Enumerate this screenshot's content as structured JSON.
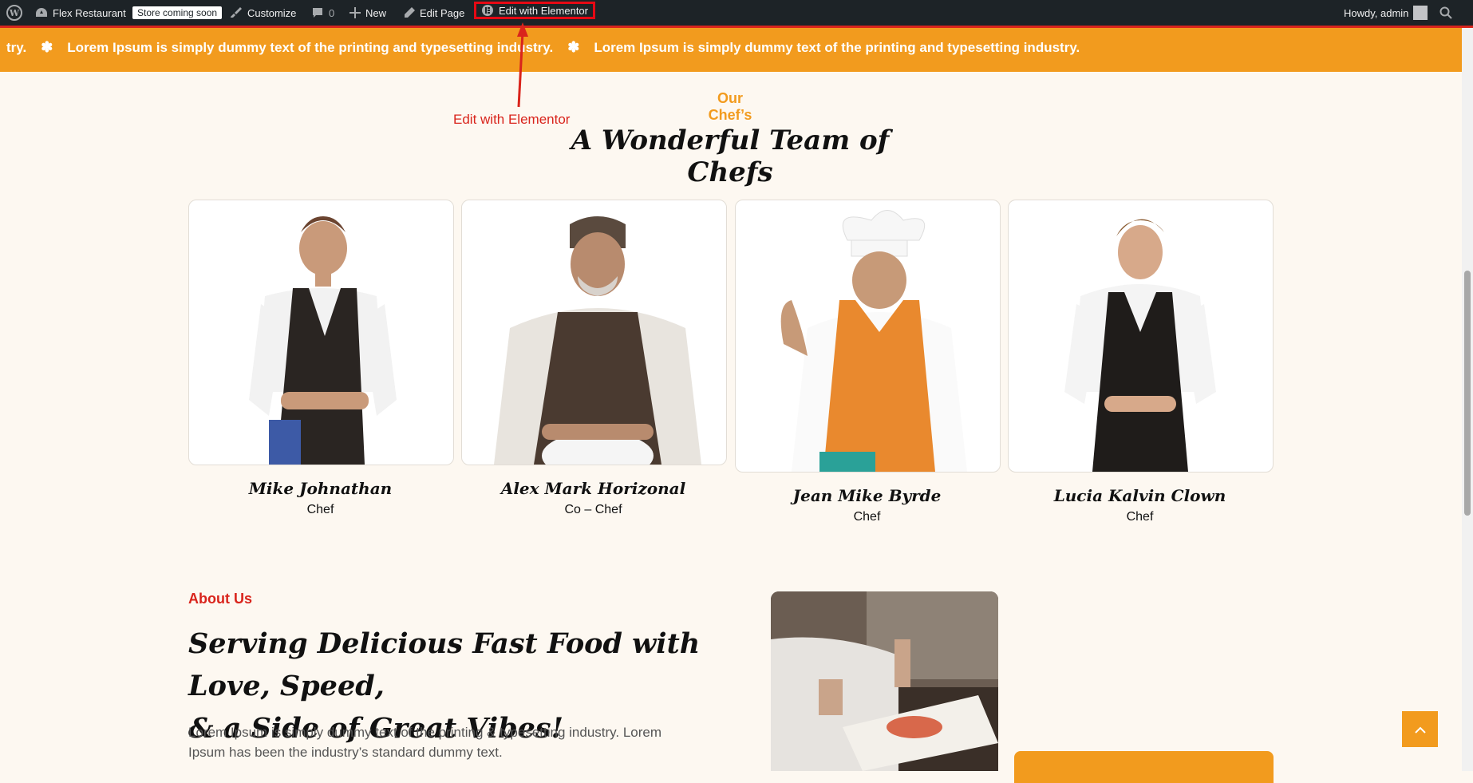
{
  "admin_bar": {
    "site_name": "Flex Restaurant",
    "store_badge": "Store coming soon",
    "customize": "Customize",
    "comments_count": "0",
    "new": "New",
    "edit_page": "Edit Page",
    "edit_elementor": "Edit with Elementor",
    "howdy": "Howdy, admin"
  },
  "ticker": {
    "lead": "try.",
    "items": [
      "Lorem Ipsum is simply dummy text of the printing and typesetting industry.",
      "Lorem Ipsum is simply dummy text of the printing and typesetting industry."
    ]
  },
  "annotation": {
    "label": "Edit with Elementor",
    "color": "#d9241c"
  },
  "chefs_section": {
    "subtitle": "Our Chef’s",
    "title": "A Wonderful Team of Chefs",
    "chefs": [
      {
        "name": "Mike Johnathan",
        "role": "Chef"
      },
      {
        "name": "Alex Mark Horizonal",
        "role": "Co – Chef"
      },
      {
        "name": "Jean Mike Byrde",
        "role": "Chef"
      },
      {
        "name": "Lucia Kalvin Clown",
        "role": "Chef"
      }
    ]
  },
  "about": {
    "label": "About Us",
    "title_line1": "Serving Delicious Fast Food with Love, Speed,",
    "title_line2": "& a Side of Great Vibes!",
    "text": "Lorem Ipsum is simply dummy text of the printing & typesetting industry. Lorem Ipsum has been the industry’s standard dummy text."
  },
  "colors": {
    "accent_orange": "#f29b1e",
    "accent_red": "#d9241c",
    "admin_bar": "#1d2327",
    "page_bg": "#fdf8f1"
  },
  "icons": [
    "wordpress-icon",
    "dashboard-icon",
    "brush-icon",
    "comment-icon",
    "plus-icon",
    "pencil-icon",
    "elementor-icon",
    "search-icon",
    "chevron-up-icon"
  ]
}
